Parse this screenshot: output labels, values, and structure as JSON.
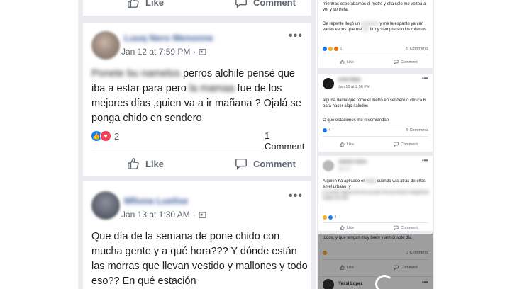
{
  "left_feed": {
    "top_actions": {
      "like_label": "Like",
      "comment_label": "Comment"
    },
    "post1": {
      "author": "Luuq Nero Menonne",
      "date": "Jan 12 at 7:59 PM",
      "text_blur_start": "Ponete bu namelos",
      "text_part1": "perros alchile pensé que iba a estar para pero",
      "text_blur_mid": "la mamaa",
      "text_part2": "fue de los mejores días ,quien va a ir mañana ? Ojalá se ponga chido en sendero",
      "reaction_count": "2",
      "comment_count": "1 Comment",
      "like_label": "Like",
      "comment_label": "Comment"
    },
    "post2": {
      "author": "Mfiona Luelise",
      "date": "Jan 13 at 1:30 AM",
      "text": "Que día de la semana de pone chido con mucha gente y a qué hora??? Y dónde están las morras que llevan vestido y mallones y todo eso?? En qué estación"
    }
  },
  "right_feed": {
    "post_a": {
      "text1": "mientras esperábamos el metro y ella solo me voltea a ver y sonreía.",
      "text2_start": "De repente llegó un",
      "text2_blur": "carterista",
      "text2_end": "y me la espanto ya van varias veces que me",
      "text2_blur2": "tiro",
      "text2_tail": "tiro y siempre son los mismos",
      "reaction_count": "6",
      "comment_count": "5 Comments",
      "like_label": "Like",
      "comment_label": "Comment"
    },
    "post_b": {
      "author": "Erika Mejia",
      "date": "Jan 10 at 2:56 PM",
      "text": "alguna dama que tome el metro en sendero o clínica 6 para hacer algo saludos",
      "comment_text": "O que estaciones me recomiendan",
      "reaction_count": "4",
      "comment_count": "5 Comments",
      "like_label": "Like",
      "comment_label": "Comment"
    },
    "post_c": {
      "author": "Jazmin Flores",
      "date": "Jan 12",
      "text_start": "Alguien ha aplicado el",
      "text_blur": "rucas",
      "text_end": "cuando vas atrás de ellas en el urbano ,y",
      "text_blur_lines": "no estoy segura de eso ya que me da mucha vergüenza hablar de ello",
      "reaction_count": "4",
      "comment_count": "5 Comments",
      "like_label": "Like",
      "comment_label": "Comment"
    },
    "post_d": {
      "text": "todos, y que tengan muy buen y armonsote día",
      "comment_count": "3 Comments",
      "like_label": "Like",
      "comment_label": "Comment",
      "next_author": "Yessi Lopez"
    }
  }
}
